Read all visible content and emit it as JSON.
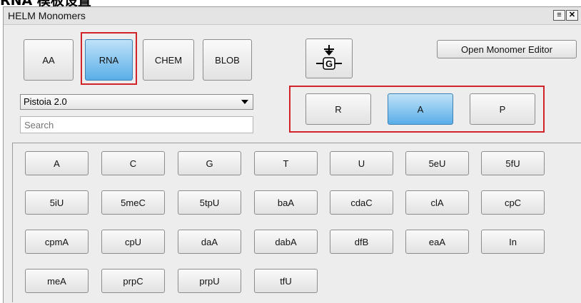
{
  "caption": "RNA 模板设置",
  "window": {
    "title": "HELM Monomers",
    "menu_btn": "≡",
    "close_btn": "✕"
  },
  "tabs": [
    {
      "label": "AA",
      "selected": false
    },
    {
      "label": "RNA",
      "selected": true
    },
    {
      "label": "CHEM",
      "selected": false
    },
    {
      "label": "BLOB",
      "selected": false
    }
  ],
  "insert_icon": "G",
  "open_editor_label": "Open Monomer Editor",
  "library": {
    "selected": "Pistoia 2.0"
  },
  "search": {
    "placeholder": "Search"
  },
  "subtabs": [
    {
      "label": "R",
      "selected": false
    },
    {
      "label": "A",
      "selected": true
    },
    {
      "label": "P",
      "selected": false
    }
  ],
  "monomers": [
    [
      "A",
      "C",
      "G",
      "T",
      "U",
      "5eU",
      "5fU"
    ],
    [
      "5iU",
      "5meC",
      "5tpU",
      "baA",
      "cdaC",
      "clA",
      "cpC"
    ],
    [
      "cpmA",
      "cpU",
      "daA",
      "dabA",
      "dfB",
      "eaA",
      "In"
    ],
    [
      "meA",
      "prpC",
      "prpU",
      "tfU"
    ]
  ],
  "colors": {
    "highlight": "#d2232a",
    "selected_button": "#5aaee8"
  }
}
